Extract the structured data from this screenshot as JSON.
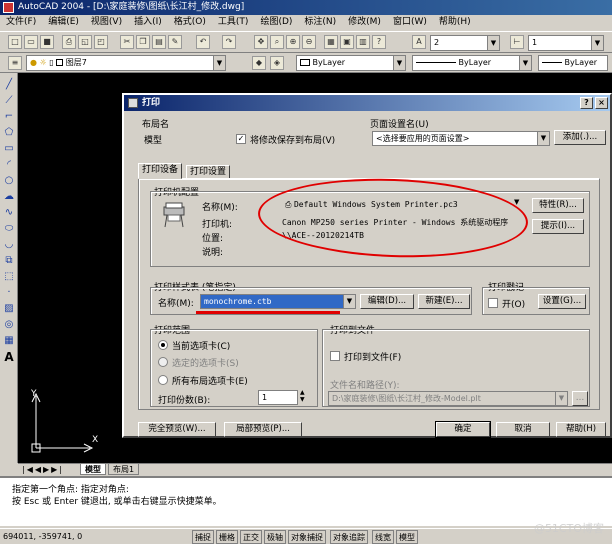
{
  "app": {
    "title": "AutoCAD 2004 - [D:\\家庭装修\\图纸\\长江村_修改.dwg]"
  },
  "menu": [
    "文件(F)",
    "编辑(E)",
    "视图(V)",
    "插入(I)",
    "格式(O)",
    "工具(T)",
    "绘图(D)",
    "标注(N)",
    "修改(M)",
    "窗口(W)",
    "帮助(H)"
  ],
  "toolbar": {
    "layer_name": "图层7",
    "textstyle_value": "2",
    "dimstyle_value": "1",
    "color_value": "ByLayer",
    "linetype_value": "ByLayer",
    "lineweight_value": "ByLayer"
  },
  "layout_tabs": {
    "model": "模型",
    "layout1": "布局1"
  },
  "command_line": {
    "line1": "指定第一个角点: 指定对角点:",
    "line2": "按 Esc 或 Enter 键退出, 或单击右键显示快捷菜单。"
  },
  "status": {
    "coords": "694011, -359741, 0",
    "buttons": [
      "捕捉",
      "栅格",
      "正交",
      "极轴",
      "对象捕捉",
      "对象追踪",
      "线宽",
      "模型"
    ]
  },
  "watermark": "@51CTO博客",
  "dialog": {
    "title": "打印",
    "layout_section_label": "布局名",
    "layout_name": "模型",
    "save_changes_label": "将修改保存到布局(V)",
    "page_setup_label": "页面设置名(U)",
    "page_setup_value": "<选择要应用的页面设置>",
    "add_button": "添加(.)...",
    "tab_plot_device": "打印设备",
    "tab_plot_settings": "打印设置",
    "printer_config_label": "打印机配置",
    "printer_name_label": "名称(M):",
    "printer_name_value": "Default Windows System Printer.pc3",
    "properties_button": "特性(R)...",
    "printer_label": "打印机:",
    "printer_value": "Canon MP250 series Printer - Windows 系统驱动程序",
    "location_label": "位置:",
    "location_value": "\\\\ACE--20120214TB",
    "description_label": "说明:",
    "hints_button": "提示(I)...",
    "plot_style_label": "打印样式表 (笔指定)",
    "plot_style_name_label": "名称(M):",
    "plot_style_value": "monochrome.ctb",
    "edit_button": "编辑(D)...",
    "new_button": "新建(E)...",
    "plot_stamp_label": "打印戳记",
    "stamp_on_label": "开(O)",
    "settings_button": "设置(G)...",
    "plot_range_label": "打印范围",
    "range_current_tab": "当前选项卡(C)",
    "range_selected_tabs": "选定的选项卡(S)",
    "range_all_layouts": "所有布局选项卡(E)",
    "copies_label": "打印份数(B):",
    "copies_value": "1",
    "plot_to_file_section": "打印到文件",
    "plot_to_file_label": "打印到文件(F)",
    "file_path_label": "文件名和路径(Y):",
    "file_path_value": "D:\\家庭装修\\图纸\\长江村_修改-Model.plt",
    "full_preview_button": "完全预览(W)...",
    "partial_preview_button": "局部预览(P)...",
    "ok_button": "确定",
    "cancel_button": "取消",
    "help_button": "帮助(H)"
  },
  "colors": {
    "annotation_red": "#e00000",
    "title_blue": "#0a246a",
    "selected_blue": "#3169c6"
  }
}
